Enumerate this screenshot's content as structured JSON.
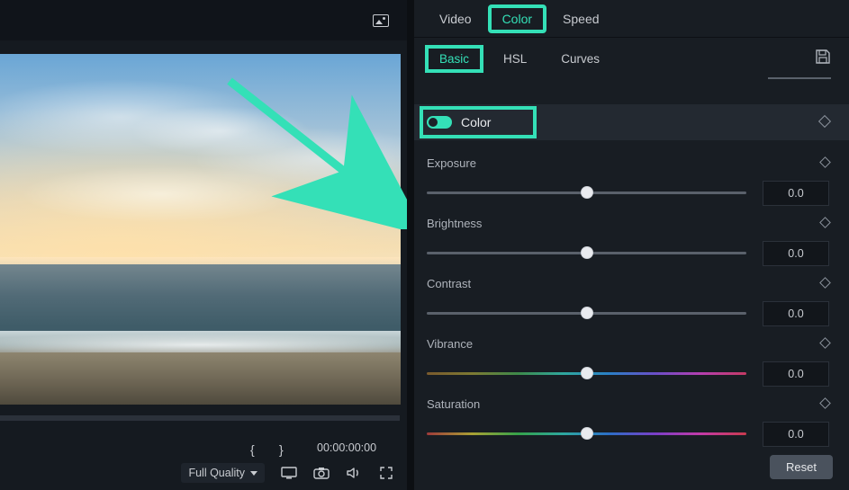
{
  "tabs": {
    "video": "Video",
    "color": "Color",
    "speed": "Speed"
  },
  "subtabs": {
    "basic": "Basic",
    "hsl": "HSL",
    "curves": "Curves"
  },
  "section": {
    "title": "Color"
  },
  "params": {
    "exposure": {
      "label": "Exposure",
      "value": "0.0"
    },
    "brightness": {
      "label": "Brightness",
      "value": "0.0"
    },
    "contrast": {
      "label": "Contrast",
      "value": "0.0"
    },
    "vibrance": {
      "label": "Vibrance",
      "value": "0.0"
    },
    "saturation": {
      "label": "Saturation",
      "value": "0.0"
    }
  },
  "transport": {
    "mark_in": "{",
    "mark_out": "}",
    "timecode": "00:00:00:00",
    "quality_label": "Full Quality"
  },
  "buttons": {
    "reset": "Reset"
  }
}
